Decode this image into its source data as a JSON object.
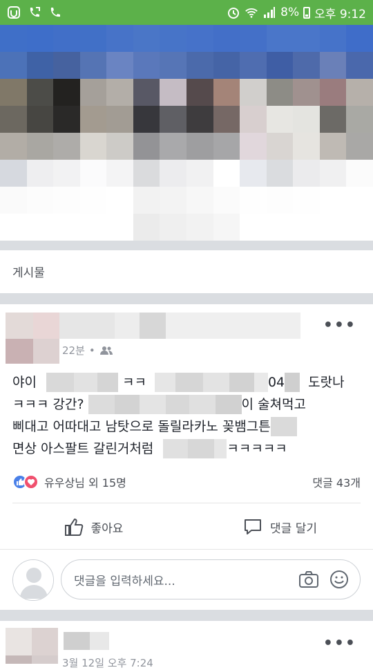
{
  "status_bar": {
    "battery": "8%",
    "time": "오후 9:12"
  },
  "section": {
    "label": "게시물"
  },
  "post": {
    "time": "22분",
    "separator": "•",
    "text_lines": [
      [
        "야이",
        "ㅋㅋ",
        "04",
        "도랏나"
      ],
      [
        "ㅋㅋㅋ 강간?",
        "이 술쳐먹고"
      ],
      [
        "삐대고 어따대고 남탓으로 돌릴라카노 꽂뱀그튼"
      ],
      [
        "면상 아스팔트 갈린거처럼",
        "ㅋㅋㅋㅋㅋ"
      ]
    ],
    "reactions_text": "유우상님 외 15명",
    "comments_count": "댓글 43개",
    "like_label": "좋아요",
    "comment_label": "댓글 달기",
    "comment_placeholder": "댓글을 입력하세요..."
  },
  "next_post": {
    "time_partial": "3월 12일 오후 7:24"
  },
  "icons": {
    "like": "thumbs-up-icon",
    "love": "heart-icon",
    "comment": "speech-bubble-icon",
    "camera": "camera-icon",
    "emoji": "smiley-icon",
    "more": "more-dots-icon"
  },
  "colors": {
    "status_bar": "#5cb14a",
    "like_blue": "#4a80e8",
    "love_red": "#f0506e"
  }
}
